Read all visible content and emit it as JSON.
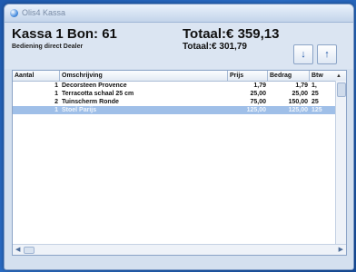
{
  "window": {
    "title": "Olis4 Kassa"
  },
  "header": {
    "title": "Kassa 1 Bon: 61",
    "subtitle": "Bediening direct Dealer",
    "total": "Totaal:€ 359,13",
    "total_excl": "Totaal:€ 301,79",
    "down_glyph": "↓",
    "up_glyph": "↑"
  },
  "table": {
    "columns": [
      "Aantal",
      "Omschrijving",
      "Prijs",
      "Bedrag",
      "Btw"
    ],
    "rows": [
      {
        "aantal": "1",
        "omschrijving": "Decorsteen Provence",
        "prijs": "1,79",
        "bedrag": "1,79",
        "btw": "1,"
      },
      {
        "aantal": "1",
        "omschrijving": "Terracotta schaal 25 cm",
        "prijs": "25,00",
        "bedrag": "25,00",
        "btw": "25"
      },
      {
        "aantal": "2",
        "omschrijving": "Tuinscherm Ronde",
        "prijs": "75,00",
        "bedrag": "150,00",
        "btw": "25"
      },
      {
        "aantal": "1",
        "omschrijving": "Stoel Parijs",
        "prijs": "125,00",
        "bedrag": "125,00",
        "btw": "125"
      }
    ]
  },
  "colors": {
    "accent": "#1d55a6",
    "selection": "#9fbfe8",
    "background": "#2a6cc4"
  }
}
